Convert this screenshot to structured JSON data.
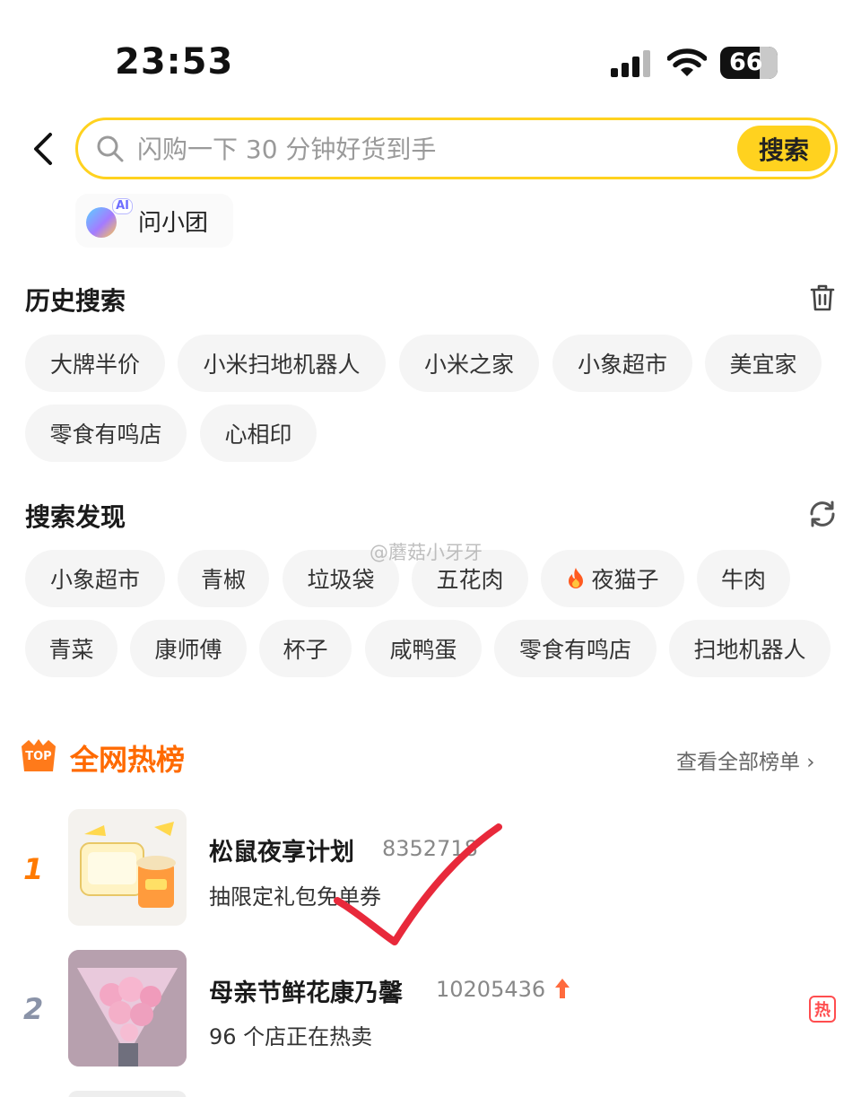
{
  "status_bar": {
    "time": "23:53",
    "battery": "66"
  },
  "search": {
    "placeholder": "闪购一下 30 分钟好货到手",
    "button": "搜索"
  },
  "ai_assistant": {
    "badge": "AI",
    "label": "问小团"
  },
  "history": {
    "title": "历史搜索",
    "items": [
      "大牌半价",
      "小米扫地机器人",
      "小米之家",
      "小象超市",
      "美宜家",
      "零食有鸣店",
      "心相印"
    ]
  },
  "discover": {
    "title": "搜索发现",
    "items": [
      "小象超市",
      "青椒",
      "垃圾袋",
      "五花肉",
      "夜猫子",
      "牛肉",
      "青菜",
      "康师傅",
      "杯子",
      "咸鸭蛋",
      "零食有鸣店",
      "扫地机器人"
    ]
  },
  "watermark": "@蘑菇小牙牙",
  "hot_list": {
    "badge": "TOP",
    "title": "全网热榜",
    "view_all": "查看全部榜单 ›",
    "items": [
      {
        "rank": "1",
        "title": "松鼠夜享计划",
        "count": "8352718",
        "subtitle": "抽限定礼包免单券"
      },
      {
        "rank": "2",
        "title": "母亲节鲜花康乃馨",
        "count": "10205436",
        "subtitle": "96 个店正在热卖",
        "tag": "热"
      }
    ]
  },
  "colors": {
    "accent": "#ffd21f",
    "hot": "#ff6a00",
    "rank1": "#ff7a00",
    "rank2": "#8a93a8",
    "trend_up": "#ff6a3d"
  }
}
